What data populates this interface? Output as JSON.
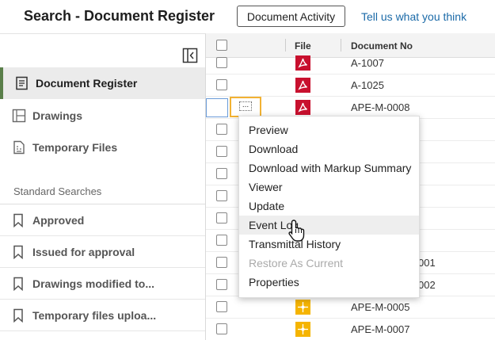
{
  "header": {
    "title": "Search - Document Register",
    "activity_button": "Document Activity",
    "feedback_link": "Tell us what you think"
  },
  "sidebar": {
    "nav": [
      {
        "label": "Document Register",
        "icon": "document-list-icon",
        "active": true
      },
      {
        "label": "Drawings",
        "icon": "drawing-icon",
        "active": false
      },
      {
        "label": "Temporary Files",
        "icon": "temporary-file-icon",
        "active": false
      }
    ],
    "section_label": "Standard Searches",
    "searches": [
      {
        "label": "Approved",
        "icon": "bookmark-icon"
      },
      {
        "label": "Issued for approval",
        "icon": "bookmark-icon"
      },
      {
        "label": "Drawings modified to...",
        "icon": "bookmark-icon"
      },
      {
        "label": "Temporary files uploa...",
        "icon": "bookmark-icon"
      }
    ]
  },
  "grid": {
    "columns": {
      "file": "File",
      "doc_no": "Document No"
    },
    "rows": [
      {
        "doc_no": "A-1007",
        "file_type": "pdf"
      },
      {
        "doc_no": "A-1025",
        "file_type": "pdf"
      },
      {
        "doc_no": "APE-M-0008",
        "file_type": "pdf"
      },
      {
        "doc_no": "",
        "file_type": "pdf"
      },
      {
        "doc_no": "",
        "file_type": "pdf"
      },
      {
        "doc_no": "",
        "file_type": "pdf"
      },
      {
        "doc_no": "",
        "file_type": "pdf"
      },
      {
        "doc_no": "",
        "file_type": "pdf"
      },
      {
        "doc_no": "",
        "file_type": "pdf"
      },
      {
        "doc_no": "001",
        "file_type": "drawing"
      },
      {
        "doc_no": "002",
        "file_type": "drawing"
      },
      {
        "doc_no": "APE-M-0005",
        "file_type": "drawing"
      },
      {
        "doc_no": "APE-M-0007",
        "file_type": "drawing"
      }
    ],
    "row_actions_label": "..."
  },
  "context_menu": {
    "items": [
      {
        "label": "Preview",
        "state": "normal"
      },
      {
        "label": "Download",
        "state": "normal"
      },
      {
        "label": "Download with Markup Summary",
        "state": "normal"
      },
      {
        "label": "Viewer",
        "state": "normal"
      },
      {
        "label": "Update",
        "state": "normal"
      },
      {
        "label": "Event Log",
        "state": "hover"
      },
      {
        "label": "Transmittal History",
        "state": "normal"
      },
      {
        "label": "Restore As Current",
        "state": "disabled"
      },
      {
        "label": "Properties",
        "state": "normal"
      }
    ]
  },
  "colors": {
    "pdf": "#c8102e",
    "drawing": "#f5b400",
    "active_nav_border": "#5a7f4a",
    "highlight_border": "#f2b233",
    "link": "#1b6aa8"
  }
}
